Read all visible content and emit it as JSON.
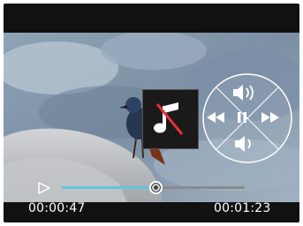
{
  "player": {
    "current_time": "00:00:47",
    "total_time": "00:01:23",
    "progress_fraction": 0.51,
    "state": "playing",
    "accent_color": "#5fc6dd"
  },
  "controls": {
    "mute_toggle_icon": "music-note-muted-icon",
    "volume_up_icon": "volume-up-icon",
    "volume_down_icon": "volume-down-icon",
    "rewind_icon": "rewind-icon",
    "pause_icon": "pause-icon",
    "fast_forward_icon": "fast-forward-icon",
    "play_icon": "play-icon"
  }
}
